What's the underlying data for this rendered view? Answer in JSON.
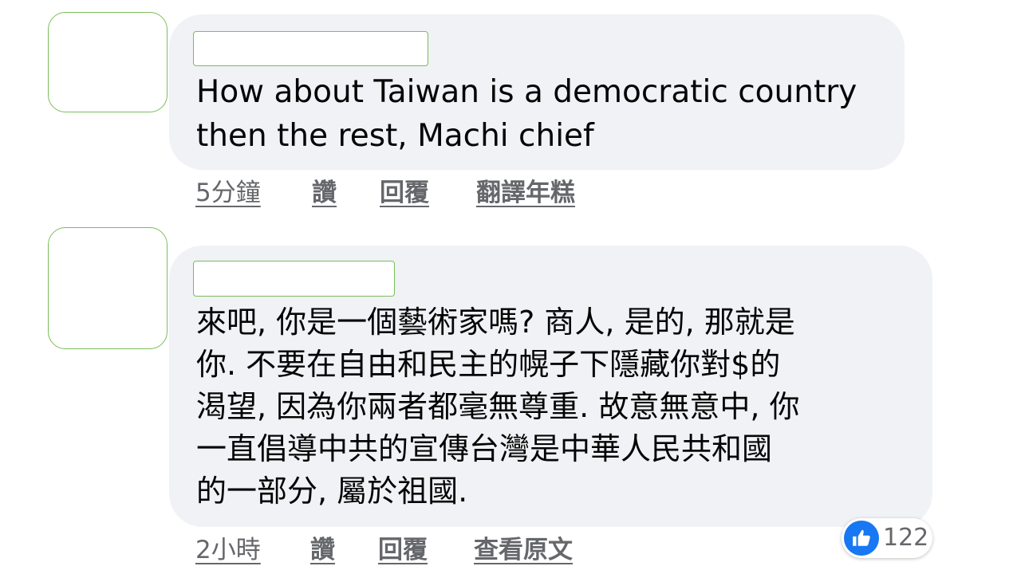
{
  "comments": [
    {
      "text_lines": [
        "How about Taiwan is a democratic country",
        "then the rest, Machi chief"
      ],
      "time": "5分鐘",
      "like": "讚",
      "reply": "回覆",
      "translate": "翻譯年糕"
    },
    {
      "text_lines": [
        "來吧, 你是一個藝術家嗎? 商人, 是的, 那就是",
        "你. 不要在自由和民主的幌子下隱藏你對$的",
        "渴望, 因為你兩者都毫無尊重. 故意無意中, 你",
        "一直倡導中共的宣傳台灣是中華人民共和國",
        "的一部分, 屬於祖國."
      ],
      "time": "2小時",
      "like": "讚",
      "reply": "回覆",
      "translate": "查看原文",
      "reaction_count": "122"
    }
  ],
  "icons": {
    "reaction": "thumbs-up-icon"
  },
  "colors": {
    "bubble": "#f0f2f5",
    "reaction_blue": "#1877f2",
    "meta_text": "#65676b"
  }
}
